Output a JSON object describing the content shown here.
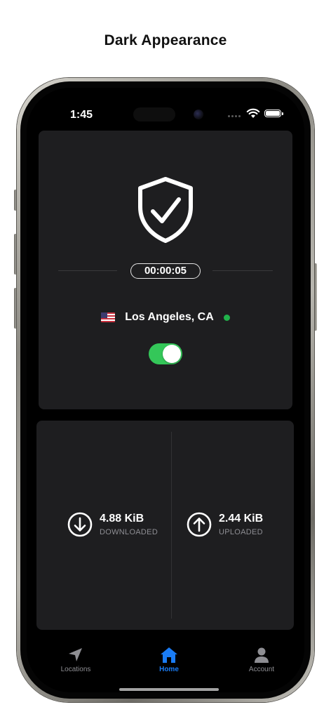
{
  "page": {
    "heading": "Dark Appearance"
  },
  "status_bar": {
    "time": "1:45"
  },
  "connection": {
    "timer": "00:00:05",
    "location": "Los Angeles, CA",
    "connected": true,
    "toggle_on": true,
    "status_color": "#21b24b",
    "toggle_color": "#34c759"
  },
  "stats": {
    "download": {
      "value": "4.88 KiB",
      "label": "DOWNLOADED",
      "icon": "arrow-down-circle-icon"
    },
    "upload": {
      "value": "2.44 KiB",
      "label": "UPLOADED",
      "icon": "arrow-up-circle-icon"
    }
  },
  "tabbar": {
    "active_color": "#1a7cf5",
    "tabs": [
      {
        "label": "Locations",
        "icon": "location-arrow-icon",
        "active": false
      },
      {
        "label": "Home",
        "icon": "home-icon",
        "active": true
      },
      {
        "label": "Account",
        "icon": "person-icon",
        "active": false
      }
    ]
  },
  "theme": {
    "screen_bg": "#000000",
    "card_bg": "#1e1e20",
    "muted_text": "#8e8e93"
  }
}
